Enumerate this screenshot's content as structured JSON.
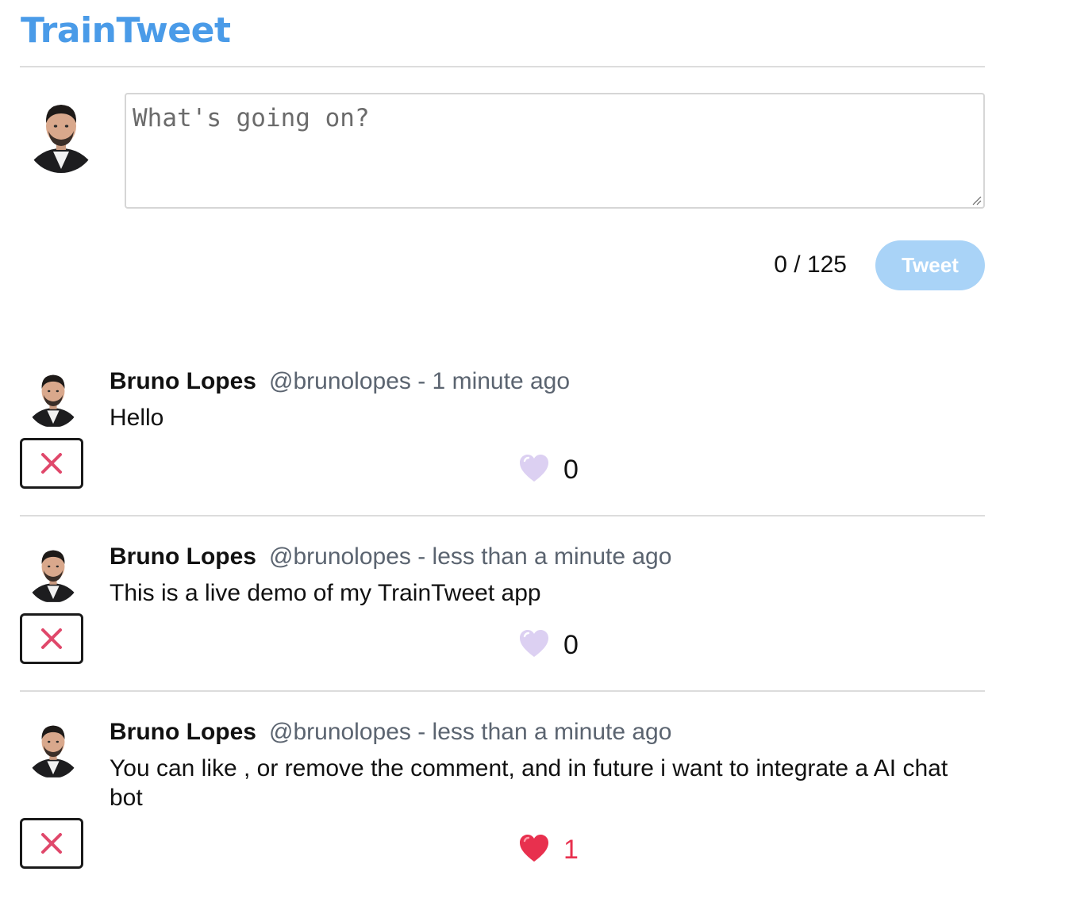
{
  "app": {
    "title": "TrainTweet"
  },
  "composer": {
    "placeholder": "What's going on?",
    "value": "",
    "char_count": "0 / 125",
    "submit_label": "Tweet"
  },
  "tweets": [
    {
      "name": "Bruno Lopes",
      "meta": "@brunolopes - 1 minute ago",
      "text": "Hello",
      "likes": "0",
      "liked": false
    },
    {
      "name": "Bruno Lopes",
      "meta": "@brunolopes - less than a minute ago",
      "text": "This is a live demo of my TrainTweet app",
      "likes": "0",
      "liked": false
    },
    {
      "name": "Bruno Lopes",
      "meta": "@brunolopes - less than a minute ago",
      "text": "You can like , or remove the comment, and in future i want to integrate a AI chat bot",
      "likes": "1",
      "liked": true
    }
  ],
  "colors": {
    "brand": "#4a9be8",
    "tweet_button_bg": "#a9d3f7",
    "delete_x": "#e0486b",
    "heart_liked": "#e8304e",
    "heart_unliked": "#d9cdef",
    "like_count_liked": "#e8304e"
  },
  "icons": {
    "delete": "close-icon",
    "like": "heart-icon",
    "avatar": "user-avatar"
  }
}
